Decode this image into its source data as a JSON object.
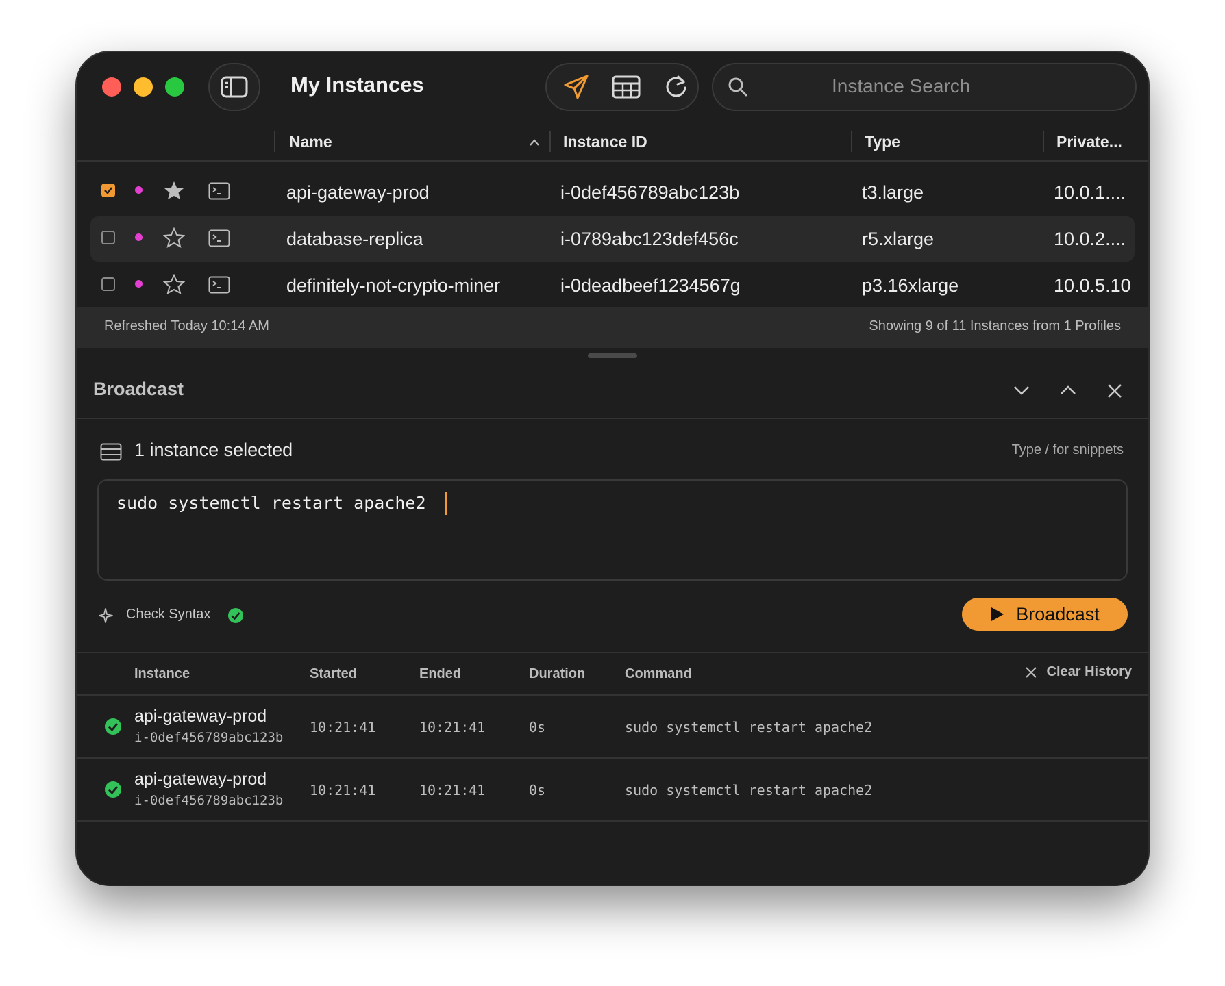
{
  "window": {
    "title": "My Instances",
    "search": {
      "placeholder": "Instance Search",
      "value": ""
    },
    "accent": "#f19a33"
  },
  "table": {
    "columns": [
      "Name",
      "Instance ID",
      "Type",
      "Private..."
    ],
    "sort_column": "Name",
    "rows": [
      {
        "checked": true,
        "starred": true,
        "name": "api-gateway-prod",
        "id": "i-0def456789abc123b",
        "type": "t3.large",
        "ip": "10.0.1...."
      },
      {
        "checked": false,
        "starred": false,
        "name": "database-replica",
        "id": "i-0789abc123def456c",
        "type": "r5.xlarge",
        "ip": "10.0.2...."
      },
      {
        "checked": false,
        "starred": false,
        "name": "definitely-not-crypto-miner",
        "id": "i-0deadbeef1234567g",
        "type": "p3.16xlarge",
        "ip": "10.0.5.10"
      }
    ]
  },
  "status": {
    "refreshed": "Refreshed Today 10:14 AM",
    "showing": "Showing 9 of 11 Instances from 1 Profiles"
  },
  "broadcast": {
    "title": "Broadcast",
    "selected_label": "1 instance selected",
    "snippet_hint": "Type / for snippets",
    "command": "sudo systemctl restart apache2",
    "check_syntax": "Check Syntax",
    "button_label": "Broadcast"
  },
  "history": {
    "columns": [
      "Instance",
      "Started",
      "Ended",
      "Duration",
      "Command"
    ],
    "clear_label": "Clear History",
    "rows": [
      {
        "name": "api-gateway-prod",
        "id": "i-0def456789abc123b",
        "started": "10:21:41",
        "ended": "10:21:41",
        "duration": "0s",
        "command": "sudo systemctl restart apache2"
      },
      {
        "name": "api-gateway-prod",
        "id": "i-0def456789abc123b",
        "started": "10:21:41",
        "ended": "10:21:41",
        "duration": "0s",
        "command": "sudo systemctl restart apache2"
      }
    ]
  }
}
